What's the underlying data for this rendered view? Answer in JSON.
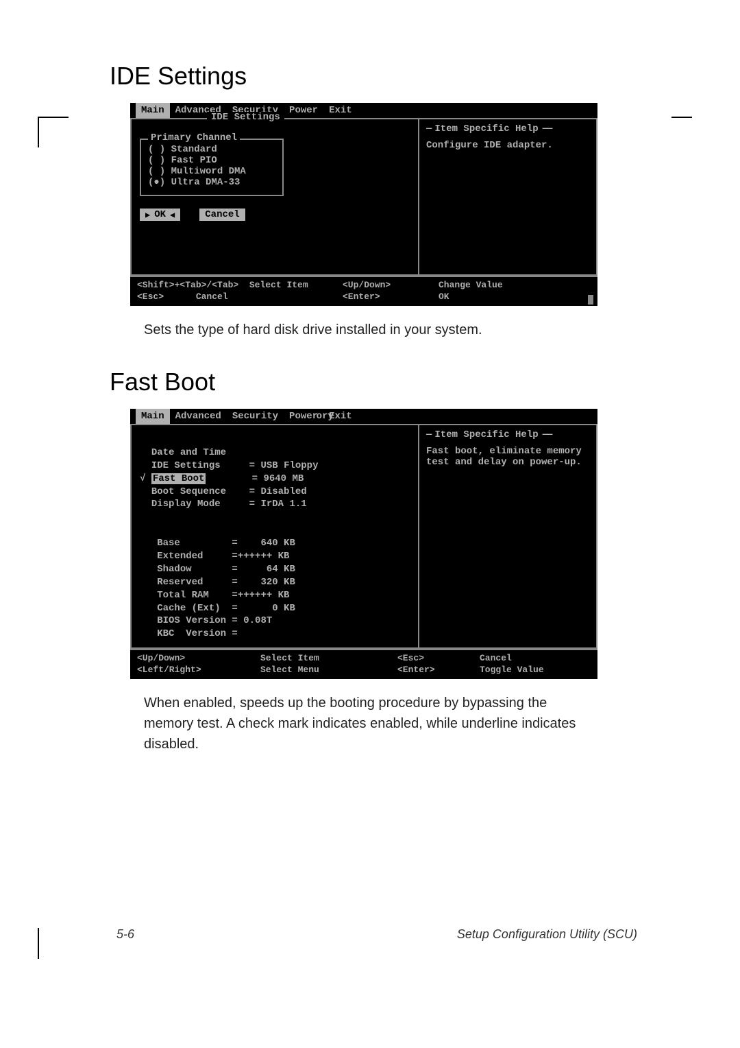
{
  "headings": {
    "ide": "IDE Settings",
    "fastboot": "Fast Boot"
  },
  "bios_menus": [
    "Main",
    "Advanced",
    "Security",
    "Power",
    "Exit"
  ],
  "ide_screen": {
    "dialog_title": "IDE Settings",
    "group_label": "Primary Channel",
    "options": [
      "( ) Standard",
      "( ) Fast PIO",
      "( ) Multiword DMA",
      "(●) Ultra DMA-33"
    ],
    "btn_ok": "OK",
    "btn_cancel": "Cancel",
    "help_title": "Item Specific Help",
    "help_text": "Configure IDE adapter.",
    "footer": {
      "k1": "<Shift>+<Tab>/<Tab>",
      "v1": "Select Item",
      "k2": "<Up/Down>",
      "v2": "Change Value",
      "k3": "<Esc>",
      "v3": "Cancel",
      "k4": "<Enter>",
      "v4": "OK"
    }
  },
  "ide_caption": "Sets the type of hard disk drive installed in your system.",
  "fb_screen": {
    "subtitle": "ory",
    "items": [
      {
        "label": "Date and Time",
        "value": ""
      },
      {
        "label": "IDE Settings",
        "value": "= USB Floppy"
      },
      {
        "label": "Fast Boot",
        "value": "= 9640 MB",
        "highlight": true,
        "checked": true
      },
      {
        "label": "Boot Sequence",
        "value": "= Disabled"
      },
      {
        "label": "Display Mode",
        "value": "= IrDA 1.1"
      }
    ],
    "memory": [
      "Base         =    640 KB",
      "Extended     =++++++ KB",
      "Shadow       =     64 KB",
      "Reserved     =    320 KB",
      "Total RAM    =++++++ KB",
      "Cache (Ext)  =      0 KB",
      "BIOS Version = 0.08T",
      "KBC  Version ="
    ],
    "help_title": "Item Specific Help",
    "help_text": "Fast boot, eliminate memory\ntest and delay on power-up.",
    "footer": {
      "k1": "<Up/Down>",
      "v1": "Select Item",
      "k2": "<Esc>",
      "v2": "Cancel",
      "k3": "<Left/Right>",
      "v3": "Select Menu",
      "k4": "<Enter>",
      "v4": "Toggle Value"
    }
  },
  "fb_caption": "When enabled, speeds up the booting procedure by bypassing the memory test. A check mark indicates enabled, while underline indicates disabled.",
  "page_footer": {
    "page_num": "5-6",
    "doc_title": "Setup Configuration Utility (SCU)"
  }
}
